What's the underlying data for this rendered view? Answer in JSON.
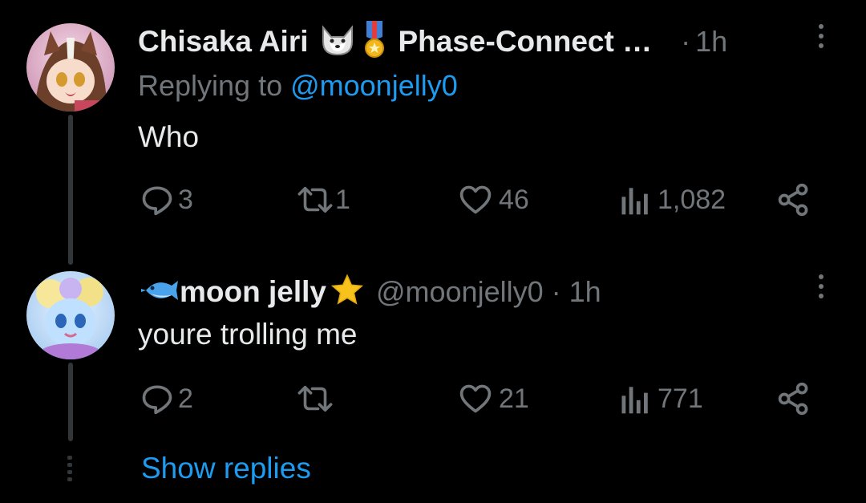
{
  "tweets": [
    {
      "author_name": "Chisaka Airi",
      "author_emojis": [
        "wolf-face-icon",
        "military-medal-icon"
      ],
      "affiliation": "Phase-Connect …",
      "separator": "·",
      "time": "1h",
      "replying_prefix": "Replying to ",
      "replying_handle": "@moonjelly0",
      "text": "Who",
      "replies": "3",
      "retweets": "1",
      "likes": "46",
      "views": "1,082"
    },
    {
      "author_name": "moon jelly",
      "author_prefix_emoji": "fish-icon",
      "author_suffix_emoji": "star-icon",
      "handle": "@moonjelly0",
      "separator": "·",
      "time": "1h",
      "text": "youre trolling me",
      "replies": "2",
      "retweets": "",
      "likes": "21",
      "views": "771"
    }
  ],
  "show_replies": "Show replies",
  "colors": {
    "background": "#000000",
    "text": "#e7e9ea",
    "muted": "#71767b",
    "accent": "#1d9bf0",
    "thread_line": "#333639"
  }
}
